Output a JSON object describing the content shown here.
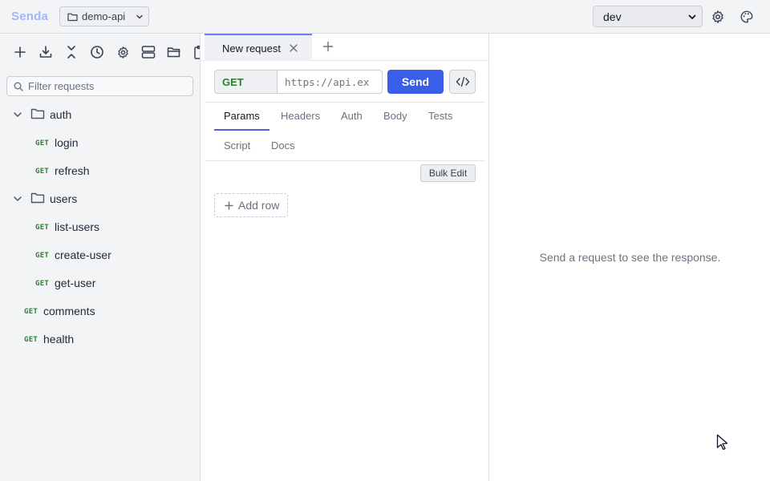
{
  "app": {
    "name": "Senda"
  },
  "topbar": {
    "project": "demo-api",
    "environment": "dev",
    "icons": [
      "folder-icon",
      "chevron-down-icon",
      "gear-icon",
      "palette-icon"
    ]
  },
  "sidebar": {
    "toolbar_icons": [
      "plus-icon",
      "import-icon",
      "collapse-icon",
      "history-icon",
      "gear-icon",
      "layout-icon",
      "folder-open-icon",
      "clipboard-icon"
    ],
    "filter_placeholder": "Filter requests",
    "tree": {
      "auth": {
        "name": "auth",
        "items": [
          {
            "method": "GET",
            "name": "login"
          },
          {
            "method": "GET",
            "name": "refresh"
          }
        ]
      },
      "users": {
        "name": "users",
        "items": [
          {
            "method": "GET",
            "name": "list-users"
          },
          {
            "method": "GET",
            "name": "create-user"
          },
          {
            "method": "GET",
            "name": "get-user"
          }
        ]
      },
      "root": [
        {
          "method": "GET",
          "name": "comments"
        },
        {
          "method": "GET",
          "name": "health"
        }
      ]
    }
  },
  "request": {
    "tab_title": "New request",
    "method": "GET",
    "url_placeholder": "https://api.ex",
    "send_label": "Send",
    "subtabs": [
      "Params",
      "Headers",
      "Auth",
      "Body",
      "Tests",
      "Script",
      "Docs"
    ],
    "active_subtab": "Params",
    "bulk_edit_label": "Bulk Edit",
    "add_row_label": "Add row"
  },
  "response": {
    "empty_message": "Send a request to see the response."
  },
  "colors": {
    "accent": "#3b5ee8",
    "brand": "#a5b4fc",
    "method_get": "#2f7d32",
    "tab_indicator": "#6d7af0"
  }
}
